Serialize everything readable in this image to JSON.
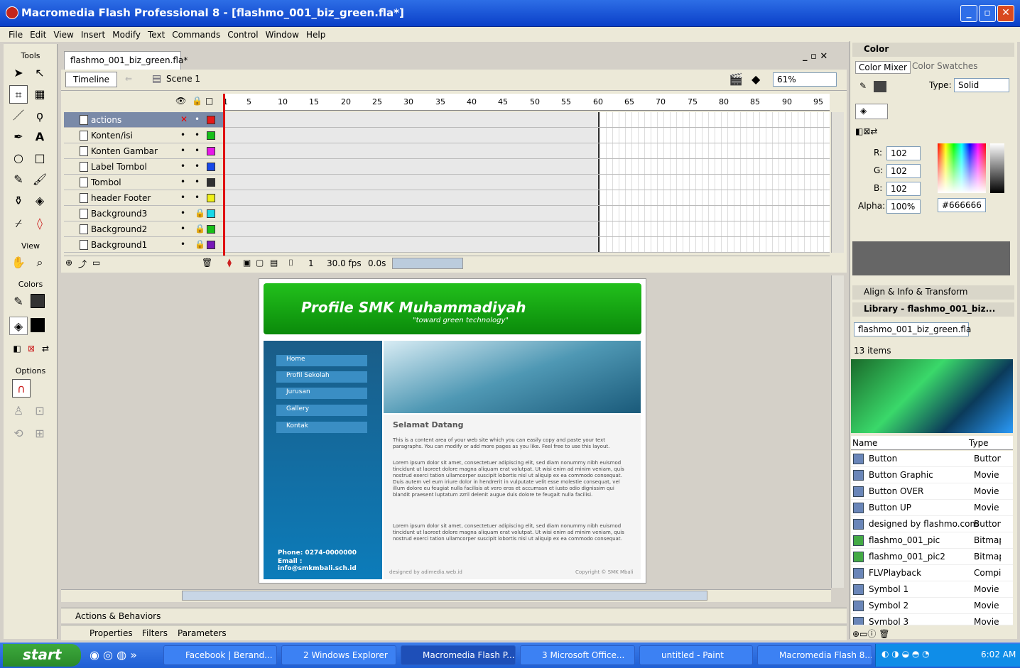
{
  "window": {
    "title": "Macromedia Flash Professional 8 - [flashmo_001_biz_green.fla*]",
    "min": "_",
    "max": "▫",
    "close": "✕"
  },
  "menu": [
    "File",
    "Edit",
    "View",
    "Insert",
    "Modify",
    "Text",
    "Commands",
    "Control",
    "Window",
    "Help"
  ],
  "tools": {
    "title": "Tools",
    "view": "View",
    "colors": "Colors",
    "options": "Options"
  },
  "doc": {
    "tab": "flashmo_001_biz_green.fla*",
    "timeline_btn": "Timeline",
    "scene": "Scene 1",
    "zoom": "61%",
    "winctrl": "_ ▫ ✕"
  },
  "ruler": [
    "1",
    "5",
    "10",
    "15",
    "20",
    "25",
    "30",
    "35",
    "40",
    "45",
    "50",
    "55",
    "60",
    "65",
    "70",
    "75",
    "80",
    "85",
    "90",
    "95"
  ],
  "layers": [
    {
      "name": "actions",
      "color": "#e81818",
      "selected": true
    },
    {
      "name": "Konten/isi",
      "color": "#18c018"
    },
    {
      "name": "Konten Gambar",
      "color": "#e818e8"
    },
    {
      "name": "Label Tombol",
      "color": "#1848e8"
    },
    {
      "name": "Tombol",
      "color": "#303030"
    },
    {
      "name": "header Footer",
      "color": "#f0f018"
    },
    {
      "name": "Background3",
      "color": "#18d8e8"
    },
    {
      "name": "Background2",
      "color": "#18c018"
    },
    {
      "name": "Background1",
      "color": "#7818b8"
    }
  ],
  "tl_footer": {
    "frame": "1",
    "fps": "30.0 fps",
    "time": "0.0s"
  },
  "stage": {
    "title": "Profile SMK Muhammadiyah",
    "subtitle": "\"toward green technology\"",
    "nav": [
      "Home",
      "Profil Sekolah",
      "Jurusan",
      "Gallery",
      "Kontak"
    ],
    "phone": "Phone: 0274-0000000",
    "email": "Email : info@smkmbali.sch.id",
    "heading": "Selamat Datang",
    "para1": "This is a content area of your web site which you can easily copy and paste your text paragraphs. You can modify or add more pages as you like. Feel free to use this layout.",
    "para2": "Lorem ipsum dolor sit amet, consectetuer adipiscing elit, sed diam nonummy nibh euismod tincidunt ut laoreet dolore magna aliquam erat volutpat. Ut wisi enim ad minim veniam, quis nostrud exerci tation ullamcorper suscipit lobortis nisl ut aliquip ex ea commodo consequat. Duis autem vel eum iriure dolor in hendrerit in vulputate velit esse molestie consequat, vel illum dolore eu feugiat nulla facilisis at vero eros et accumsan et iusto odio dignissim qui blandit praesent luptatum zzril delenit augue duis dolore te feugait nulla facilisi.",
    "para3": "Lorem ipsum dolor sit amet, consectetuer adipiscing elit, sed diam nonummy nibh euismod tincidunt ut laoreet dolore magna aliquam erat volutpat. Ut wisi enim ad minim veniam, quis nostrud exerci tation ullamcorper suscipit lobortis nisl ut aliquip ex ea commodo consequat.",
    "designed": "designed by adimedia.web.id",
    "copyright": "Copyright © SMK Mbali"
  },
  "panels": {
    "actions": "Actions & Behaviors",
    "properties": "Properties",
    "filters": "Filters",
    "parameters": "Parameters"
  },
  "color": {
    "header": "Color",
    "tab1": "Color Mixer",
    "tab2": "Color Swatches",
    "type_label": "Type:",
    "type": "Solid",
    "r_label": "R:",
    "r": "102",
    "g_label": "G:",
    "g": "102",
    "b_label": "B:",
    "b": "102",
    "alpha_label": "Alpha:",
    "alpha": "100%",
    "hex": "#666666"
  },
  "align": "Align & Info & Transform",
  "library": {
    "header": "Library - flashmo_001_biz...",
    "select": "flashmo_001_biz_green.fla",
    "count": "13 items",
    "col_name": "Name",
    "col_type": "Type",
    "items": [
      {
        "name": "Button",
        "type": "Button"
      },
      {
        "name": "Button Graphic",
        "type": "Movie Clip"
      },
      {
        "name": "Button OVER",
        "type": "Movie Clip"
      },
      {
        "name": "Button UP",
        "type": "Movie Clip"
      },
      {
        "name": "designed by flashmo.com",
        "type": "Button"
      },
      {
        "name": "flashmo_001_pic",
        "type": "Bitmap"
      },
      {
        "name": "flashmo_001_pic2",
        "type": "Bitmap"
      },
      {
        "name": "FLVPlayback",
        "type": "Compiled"
      },
      {
        "name": "Symbol 1",
        "type": "Movie Clip"
      },
      {
        "name": "Symbol 2",
        "type": "Movie Clip"
      },
      {
        "name": "Symbol 3",
        "type": "Movie Clip"
      }
    ]
  },
  "taskbar": {
    "start": "start",
    "tasks": [
      "Facebook | Berand...",
      "2 Windows Explorer",
      "Macromedia Flash P...",
      "3 Microsoft Office...",
      "untitled - Paint",
      "Macromedia Flash 8..."
    ],
    "clock": "6:02 AM"
  }
}
